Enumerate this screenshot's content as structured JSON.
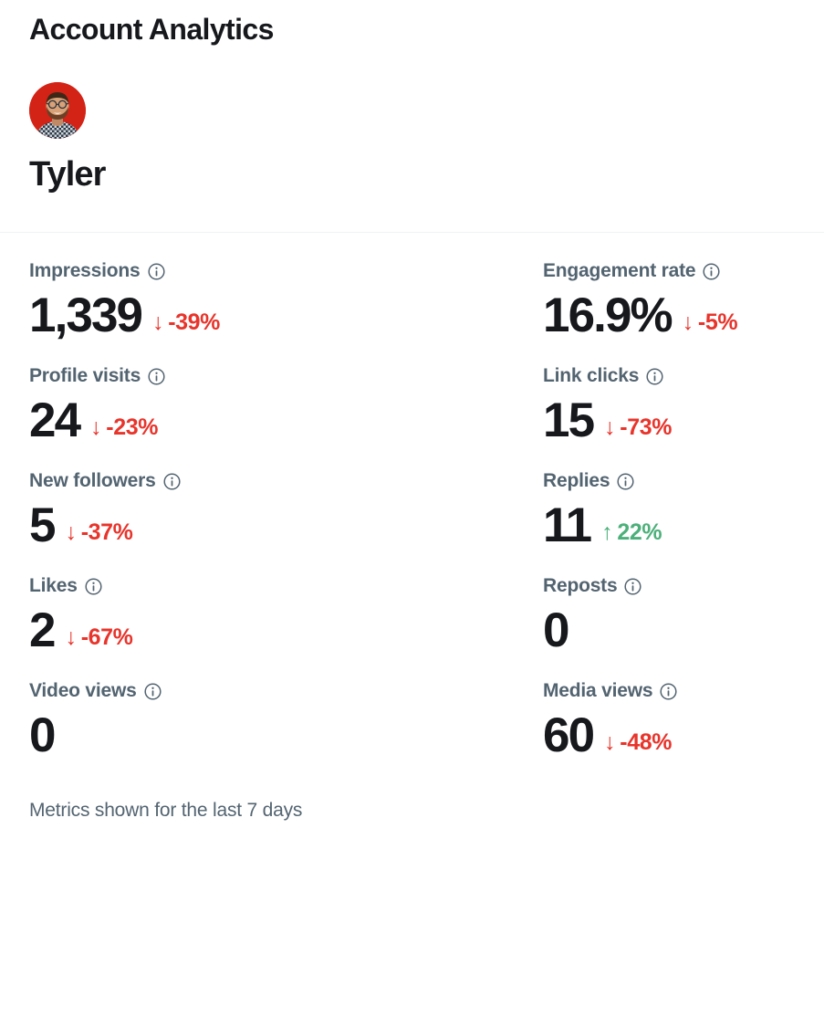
{
  "header": {
    "title": "Account Analytics"
  },
  "profile": {
    "name": "Tyler",
    "avatar_icon": "user-avatar",
    "avatar_background": "#d32316"
  },
  "colors": {
    "text_primary": "#16181c",
    "text_secondary": "#536471",
    "negative": "#e8342b",
    "positive": "#4cb07a",
    "divider": "#eff3f4",
    "background": "#ffffff"
  },
  "metrics": [
    {
      "label": "Impressions",
      "value": "1,339",
      "delta": "-39%",
      "direction": "down",
      "arrow": "↓",
      "info_icon": "info-icon"
    },
    {
      "label": "Engagement rate",
      "value": "16.9%",
      "delta": "-5%",
      "direction": "down",
      "arrow": "↓",
      "info_icon": "info-icon"
    },
    {
      "label": "Profile visits",
      "value": "24",
      "delta": "-23%",
      "direction": "down",
      "arrow": "↓",
      "info_icon": "info-icon"
    },
    {
      "label": "Link clicks",
      "value": "15",
      "delta": "-73%",
      "direction": "down",
      "arrow": "↓",
      "info_icon": "info-icon"
    },
    {
      "label": "New followers",
      "value": "5",
      "delta": "-37%",
      "direction": "down",
      "arrow": "↓",
      "info_icon": "info-icon"
    },
    {
      "label": "Replies",
      "value": "11",
      "delta": "22%",
      "direction": "up",
      "arrow": "↑",
      "info_icon": "info-icon"
    },
    {
      "label": "Likes",
      "value": "2",
      "delta": "-67%",
      "direction": "down",
      "arrow": "↓",
      "info_icon": "info-icon"
    },
    {
      "label": "Reposts",
      "value": "0",
      "delta": "",
      "direction": "none",
      "arrow": "",
      "info_icon": "info-icon"
    },
    {
      "label": "Video views",
      "value": "0",
      "delta": "",
      "direction": "none",
      "arrow": "",
      "info_icon": "info-icon"
    },
    {
      "label": "Media views",
      "value": "60",
      "delta": "-48%",
      "direction": "down",
      "arrow": "↓",
      "info_icon": "info-icon"
    }
  ],
  "footer": {
    "note": "Metrics shown for the last 7 days"
  }
}
